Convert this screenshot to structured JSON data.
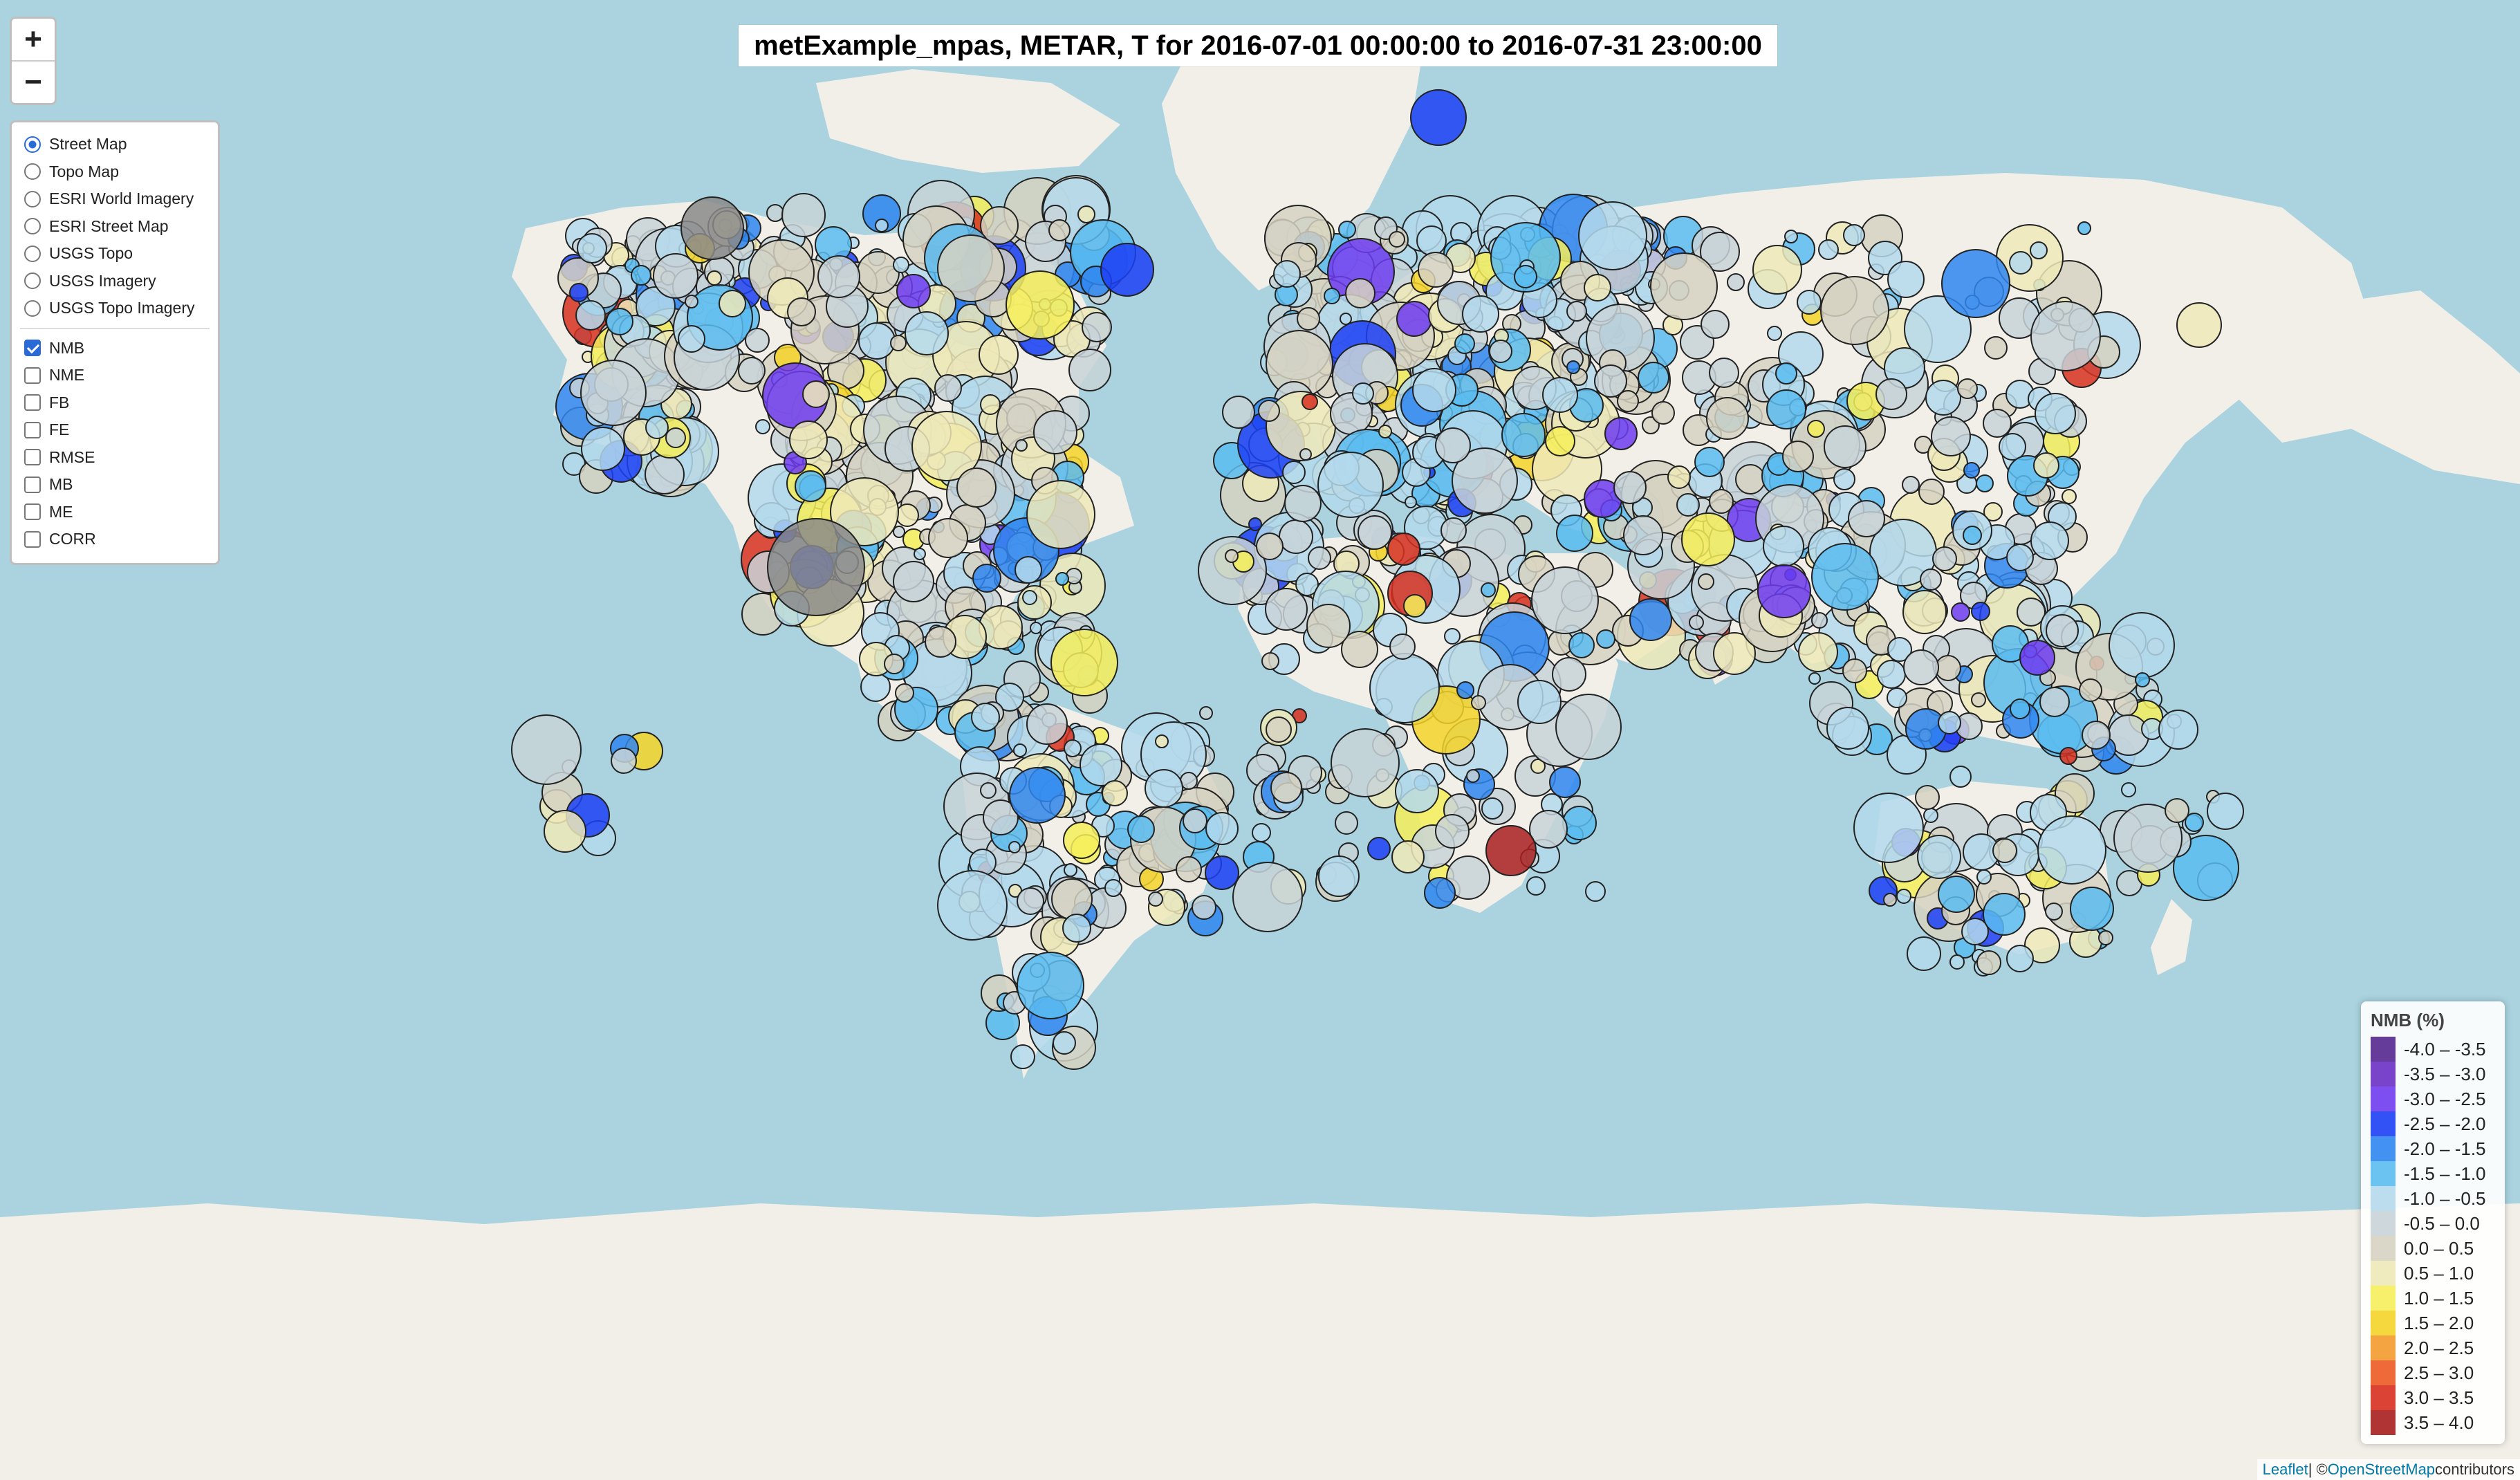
{
  "title": "metExample_mpas, METAR, T for 2016-07-01 00:00:00 to 2016-07-31 23:00:00",
  "zoom": {
    "in_label": "+",
    "out_label": "−"
  },
  "base_layers": [
    {
      "label": "Street Map",
      "selected": true
    },
    {
      "label": "Topo Map",
      "selected": false
    },
    {
      "label": "ESRI World Imagery",
      "selected": false
    },
    {
      "label": "ESRI Street Map",
      "selected": false
    },
    {
      "label": "USGS Topo",
      "selected": false
    },
    {
      "label": "USGS Imagery",
      "selected": false
    },
    {
      "label": "USGS Topo Imagery",
      "selected": false
    }
  ],
  "overlays": [
    {
      "label": "NMB",
      "checked": true
    },
    {
      "label": "NME",
      "checked": false
    },
    {
      "label": "FB",
      "checked": false
    },
    {
      "label": "FE",
      "checked": false
    },
    {
      "label": "RMSE",
      "checked": false
    },
    {
      "label": "MB",
      "checked": false
    },
    {
      "label": "ME",
      "checked": false
    },
    {
      "label": "CORR",
      "checked": false
    }
  ],
  "legend": {
    "title": "NMB (%)",
    "items": [
      {
        "label": "-4.0 – -3.5",
        "color": "#54278f"
      },
      {
        "label": "-3.5 – -3.0",
        "color": "#6a2fc4"
      },
      {
        "label": "-3.0 – -2.5",
        "color": "#6f3cf0"
      },
      {
        "label": "-2.5 – -2.0",
        "color": "#1c3ff5"
      },
      {
        "label": "-2.0 – -1.5",
        "color": "#2f86f0"
      },
      {
        "label": "-1.5 – -1.0",
        "color": "#5bbcf0"
      },
      {
        "label": "-1.0 – -0.5",
        "color": "#b4d9ec"
      },
      {
        "label": "-0.5 – 0.0",
        "color": "#c8d3d8"
      },
      {
        "label": "0.0 – 0.5",
        "color": "#d6d2c2"
      },
      {
        "label": "0.5 – 1.0",
        "color": "#eee9b8"
      },
      {
        "label": "1.0 – 1.5",
        "color": "#f6ee5a"
      },
      {
        "label": "1.5 – 2.0",
        "color": "#f4d428"
      },
      {
        "label": "2.0 – 2.5",
        "color": "#f39a2c"
      },
      {
        "label": "2.5 – 3.0",
        "color": "#ec5a24"
      },
      {
        "label": "3.0 – 3.5",
        "color": "#d7301f"
      },
      {
        "label": "3.5 – 4.0",
        "color": "#a81e1e"
      }
    ]
  },
  "attribution": {
    "leaflet": "Leaflet",
    "sep": " | © ",
    "osm": "OpenStreetMap",
    "suffix": " contributors"
  },
  "colors": {
    "ocean": "#aad3df",
    "land": "#f2efe9",
    "marker_stroke": "#222222"
  }
}
